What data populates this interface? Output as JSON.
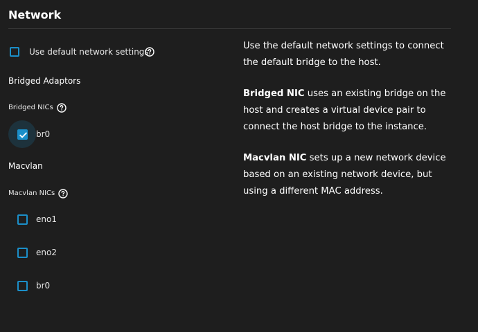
{
  "header": {
    "title": "Network"
  },
  "default_settings": {
    "label": "Use default network settings",
    "checked": false,
    "help_icon": "question-circle-icon"
  },
  "bridged": {
    "section_title": "Bridged Adaptors",
    "group_label": "Bridged NICs",
    "help_icon": "question-circle-icon",
    "items": [
      {
        "label": "br0",
        "checked": true
      }
    ]
  },
  "macvlan": {
    "section_title": "Macvlan",
    "group_label": "Macvlan NICs",
    "help_icon": "question-circle-icon",
    "items": [
      {
        "label": "eno1",
        "checked": false
      },
      {
        "label": "eno2",
        "checked": false
      },
      {
        "label": "br0",
        "checked": false
      }
    ]
  },
  "help": {
    "default_text": "Use the default network settings to connect the default bridge to the host.",
    "bridged_term": "Bridged NIC",
    "bridged_text": " uses an existing bridge on the host and creates a virtual device pair to connect the host bridge to the instance.",
    "macvlan_term": "Macvlan NIC",
    "macvlan_text": " sets up a new network device based on an existing network device, but using a different MAC address."
  },
  "colors": {
    "background": "#1e1e1e",
    "accent": "#1b8fc9",
    "divider": "#3a3a3a",
    "text": "#ffffff"
  }
}
